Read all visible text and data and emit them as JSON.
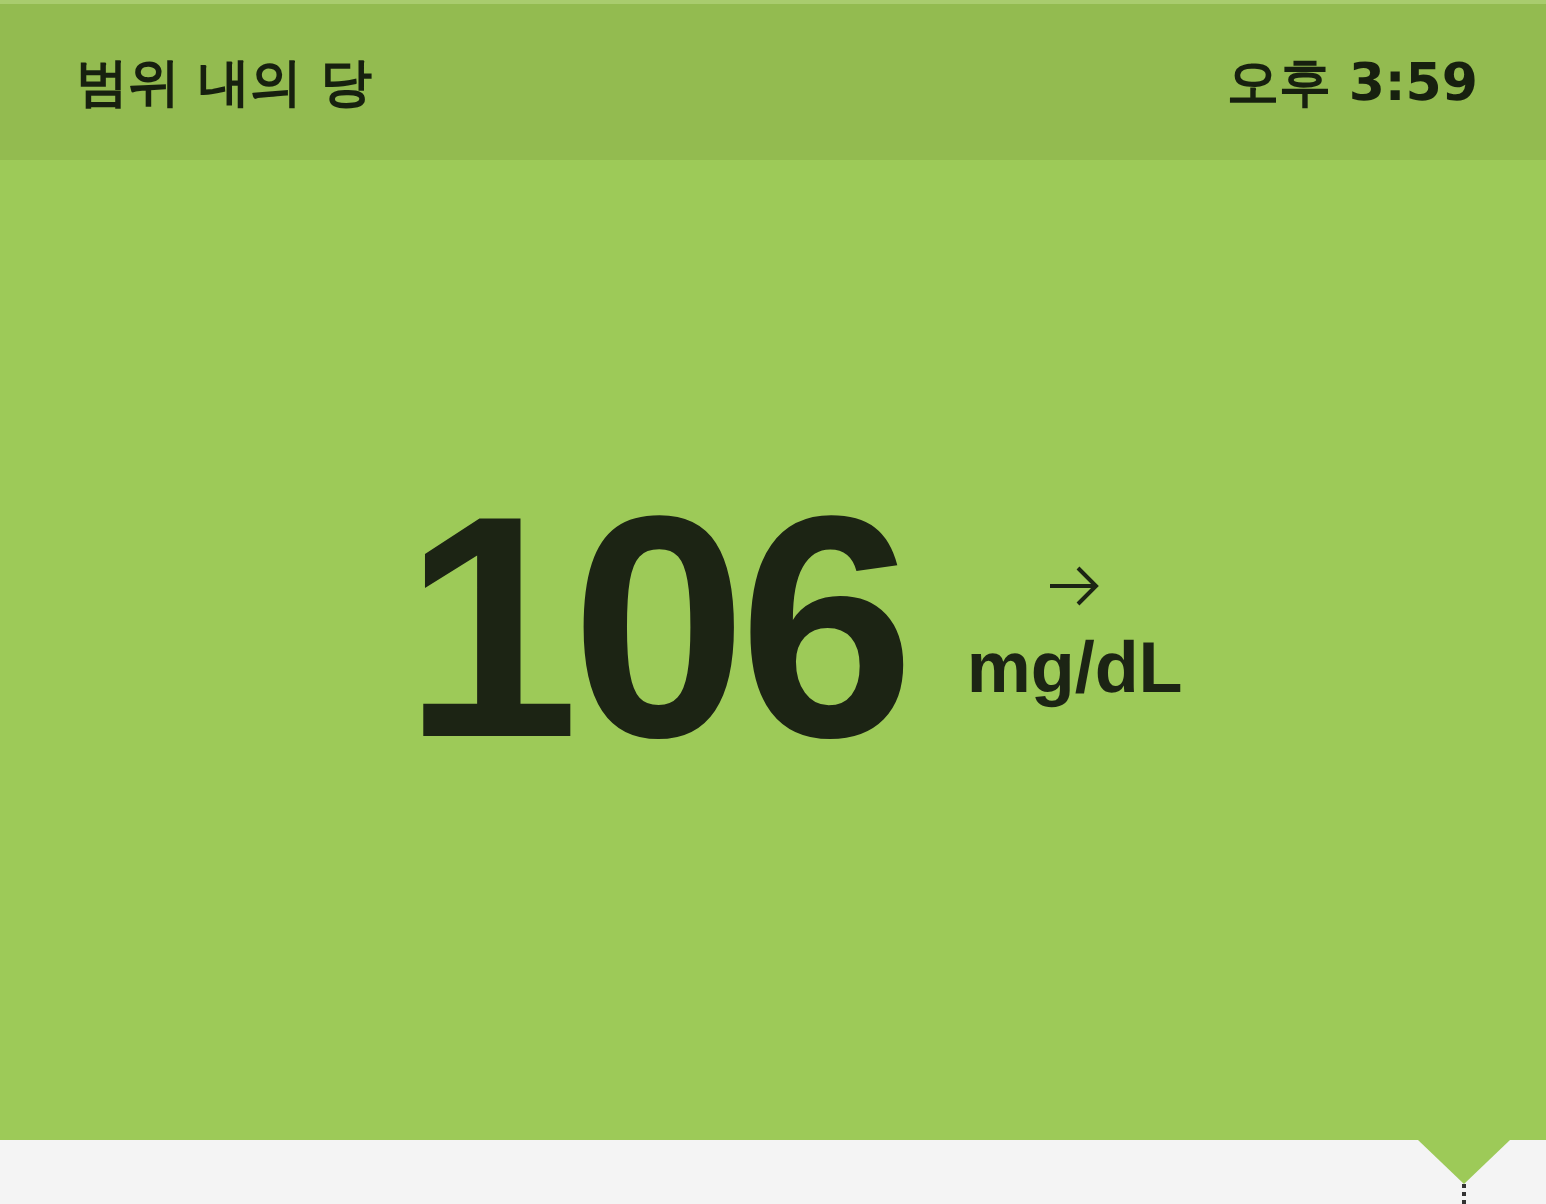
{
  "header": {
    "status": "범위 내의 당",
    "time": "오후 3:59"
  },
  "reading": {
    "value": "106",
    "unit": "mg/dL"
  }
}
